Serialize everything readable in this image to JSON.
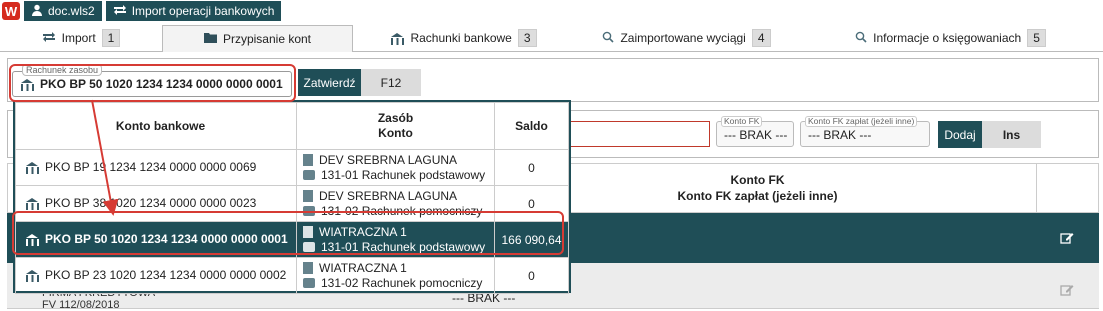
{
  "topbar": {
    "logo": "W",
    "user_label": "doc.wls2",
    "module_label": "Import operacji bankowych"
  },
  "tabs": [
    {
      "label": "Import",
      "count": "1"
    },
    {
      "label": "Przypisanie kont",
      "count": ""
    },
    {
      "label": "Rachunki bankowe",
      "count": "3"
    },
    {
      "label": "Zaimportowane wyciągi",
      "count": "4"
    },
    {
      "label": "Informacje o księgowaniach",
      "count": "5"
    }
  ],
  "account_selector": {
    "legend": "Rachunek zasobu",
    "value": "PKO BP 50 1020 1234 1234 0000 0000 0001",
    "confirm_label": "Zatwierdź",
    "shortcut_label": "F12"
  },
  "form": {
    "konto_fk_legend": "Konto FK",
    "konto_fk_value": "--- BRAK ---",
    "konto_fk_zaplat_legend": "Konto FK zapłat (jeżeli inne)",
    "konto_fk_zaplat_value": "--- BRAK ---",
    "add_label": "Dodaj",
    "add_shortcut": "Ins"
  },
  "background_table": {
    "header_line1": "Konto FK",
    "header_line2": "Konto FK zapłat (jeżeli inne)",
    "row2_text1": "FIRMA I KREDYTOWA",
    "row2_text2": "FV 112/08/2018",
    "row2_brak": "--- BRAK ---"
  },
  "popup": {
    "headers": {
      "konto_bankowe": "Konto bankowe",
      "zasob": "Zasób",
      "konto": "Konto",
      "saldo": "Saldo"
    },
    "rows": [
      {
        "account": "PKO BP 19 1234 1234 0000 0000 0069",
        "resource": "DEV SREBRNA LAGUNA",
        "fk": "131-01 Rachunek podstawowy",
        "saldo": "0"
      },
      {
        "account": "PKO BP 38 1020 1234 0000 0000 0023",
        "resource": "DEV SREBRNA LAGUNA",
        "fk": "131-02 Rachunek pomocniczy",
        "saldo": "0"
      },
      {
        "account": "PKO BP 50 1020 1234 1234 0000 0000 0001",
        "resource": "WIATRACZNA 1",
        "fk": "131-01 Rachunek podstawowy",
        "saldo": "166 090,64"
      },
      {
        "account": "PKO BP 23 1020 1234 1234 0000 0000 0002",
        "resource": "WIATRACZNA 1",
        "fk": "131-02 Rachunek pomocniczy",
        "saldo": "0"
      }
    ]
  },
  "colors": {
    "accent": "#1f4e57",
    "highlight": "#d63b34",
    "logo": "#d52b1e"
  }
}
